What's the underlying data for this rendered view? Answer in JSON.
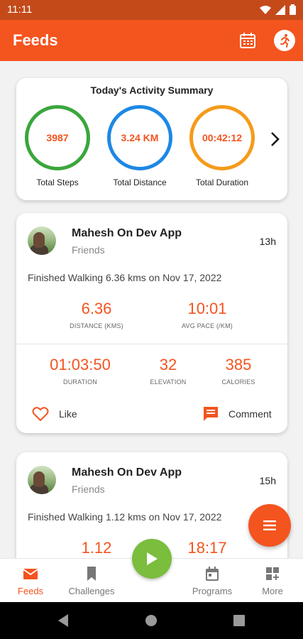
{
  "status_bar": {
    "time": "11:11"
  },
  "app_bar": {
    "title": "Feeds",
    "calendar_icon": "calendar-icon",
    "profile_icon": "runner-icon"
  },
  "summary": {
    "title": "Today's Activity Summary",
    "items": [
      {
        "value": "3987",
        "label": "Total Steps",
        "color": "#3aa63c"
      },
      {
        "value": "3.24 KM",
        "label": "Total Distance",
        "color": "#1e88e5"
      },
      {
        "value": "00:42:12",
        "label": "Total Duration",
        "color": "#f59b1b"
      }
    ]
  },
  "feeds": [
    {
      "name": "Mahesh On Dev App",
      "group": "Friends",
      "ago": "13h",
      "activity": "Finished Walking 6.36 kms on Nov 17, 2022",
      "distance": {
        "value": "6.36",
        "label": "DISTANCE (KMS)"
      },
      "pace": {
        "value": "10:01",
        "label": "AVG PACE (/KM)"
      },
      "duration": {
        "value": "01:03:50",
        "label": "DURATION"
      },
      "elevation": {
        "value": "32",
        "label": "ELEVATION"
      },
      "calories": {
        "value": "385",
        "label": "CALORIES"
      },
      "like_label": "Like",
      "comment_label": "Comment"
    },
    {
      "name": "Mahesh On Dev App",
      "group": "Friends",
      "ago": "15h",
      "activity": "Finished Walking 1.12 kms on Nov 17, 2022",
      "distance": {
        "value": "1.12"
      },
      "pace": {
        "value": "18:17"
      }
    }
  ],
  "bottom_nav": {
    "items": [
      {
        "label": "Feeds",
        "icon": "mail-icon",
        "active": true
      },
      {
        "label": "Challenges",
        "icon": "bookmark-icon"
      },
      {
        "label": "Programs",
        "icon": "calendar-icon"
      },
      {
        "label": "More",
        "icon": "grid-plus-icon"
      }
    ]
  },
  "colors": {
    "accent": "#f4541e",
    "play": "#7bbd3d"
  }
}
